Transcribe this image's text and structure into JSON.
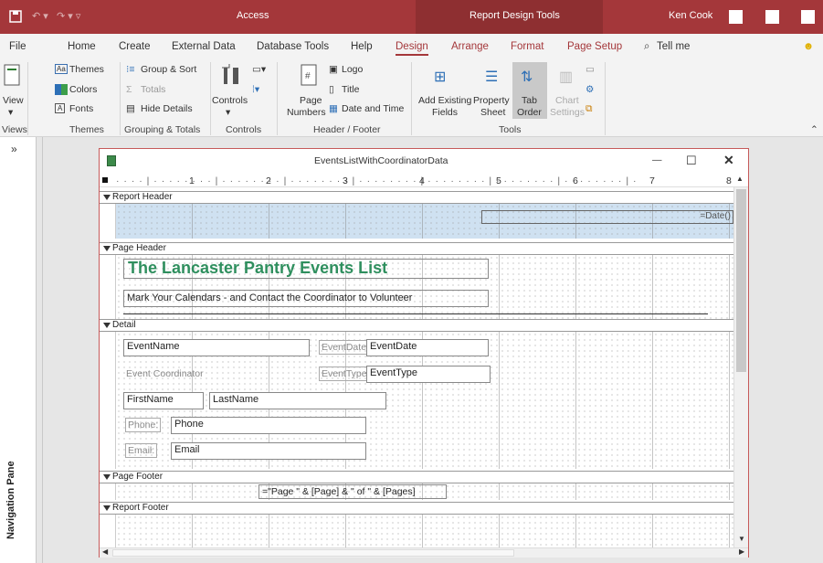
{
  "titlebar": {
    "app": "Access",
    "context": "Report Design Tools",
    "user": "Ken Cook"
  },
  "tabs": [
    "File",
    "Home",
    "Create",
    "External Data",
    "Database Tools",
    "Help",
    "Design",
    "Arrange",
    "Format",
    "Page Setup"
  ],
  "tell_me": "Tell me",
  "ribbon": {
    "view": "View",
    "themes": "Themes",
    "colors": "Colors",
    "fonts": "Fonts",
    "group_sort": "Group & Sort",
    "totals": "Totals",
    "hide_details": "Hide Details",
    "controls": "Controls",
    "page": "Page",
    "numbers": "Numbers",
    "logo": "Logo",
    "title": "Title",
    "date_time": "Date and Time",
    "add_existing": "Add Existing",
    "fields": "Fields",
    "property": "Property",
    "sheet": "Sheet",
    "tab": "Tab",
    "order": "Order",
    "chart": "Chart",
    "settings": "Settings",
    "groups": {
      "views": "Views",
      "themes": "Themes",
      "grouping": "Grouping & Totals",
      "controls": "Controls",
      "header_footer": "Header / Footer",
      "tools": "Tools"
    }
  },
  "nav_pane": "Navigation Pane",
  "nav_collapse": "»",
  "report": {
    "window_title": "EventsListWithCoordinatorData",
    "ruler": [
      "1",
      "2",
      "3",
      "4",
      "5",
      "6",
      "7",
      "8"
    ],
    "bands": {
      "report_header": "Report Header",
      "page_header": "Page Header",
      "detail": "Detail",
      "page_footer": "Page Footer",
      "report_footer": "Report Footer"
    },
    "date_ctl": "=Date()",
    "title": "The Lancaster Pantry Events List",
    "subtitle": "Mark Your Calendars - and Contact the Coordinator to Volunteer",
    "fields": {
      "event_name": "EventName",
      "event_date_lbl": "EventDate:",
      "event_date": "EventDate",
      "event_coord_lbl": "Event Coordinator",
      "event_type_lbl": "EventType:",
      "event_type": "EventType",
      "first_name": "FirstName",
      "last_name": "LastName",
      "phone_lbl": "Phone:",
      "phone": "Phone",
      "email_lbl": "Email:",
      "email": "Email"
    },
    "page_footer_expr": "=\"Page \" & [Page] & \" of \" & [Pages]"
  }
}
